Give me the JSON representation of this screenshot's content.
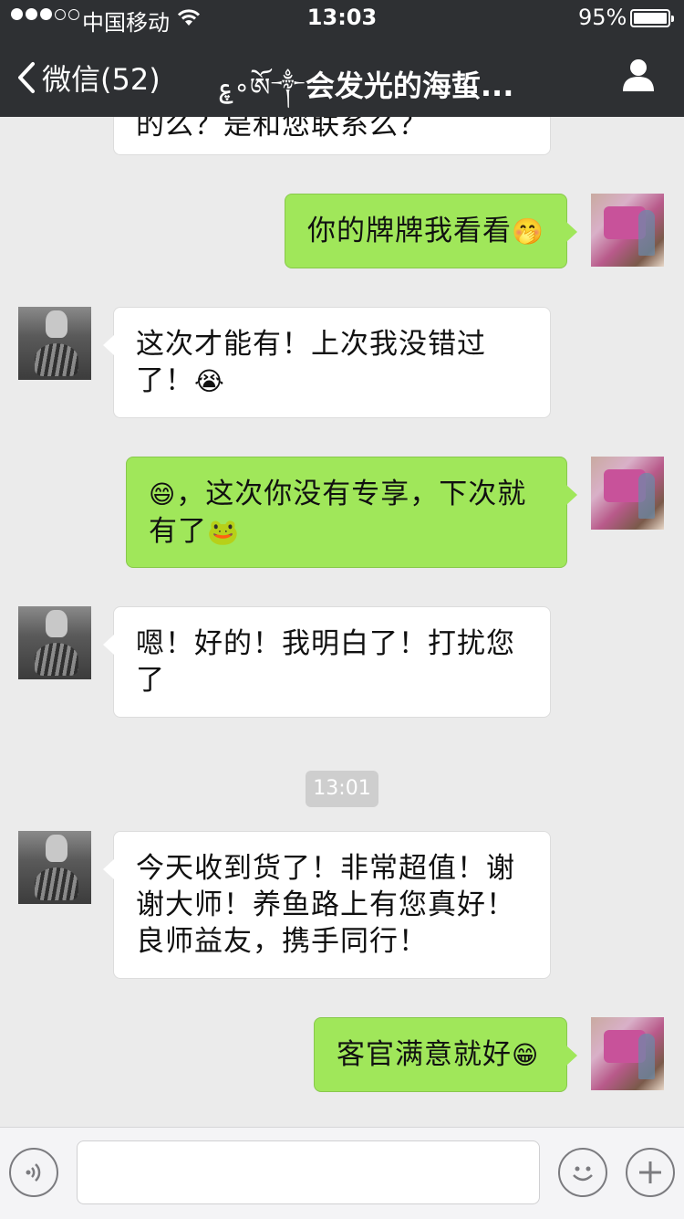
{
  "status_bar": {
    "carrier": "中国移动",
    "time": "13:03",
    "battery_percent": "95%",
    "battery_level": 0.95,
    "signal_bars_filled": 3,
    "signal_bars_total": 5
  },
  "nav": {
    "back_label": "微信(52)",
    "title_decoration": "ࢳ∘ཨོ༒",
    "title": "会发光的海蜇...",
    "profile_icon": "person-icon"
  },
  "messages": [
    {
      "side": "in",
      "text": "的么？是和您联系么？",
      "emoji": ""
    },
    {
      "side": "out",
      "text": "你的牌牌我看看",
      "emoji": "🤭"
    },
    {
      "side": "in",
      "text": "这次才能有！上次我没错过了！",
      "emoji": "😭"
    },
    {
      "side": "out",
      "text": "，这次你没有专享，下次就有了",
      "lead_emoji": "😄",
      "emoji": "🐸"
    },
    {
      "side": "in",
      "text": "嗯！好的！我明白了！打扰您了",
      "emoji": ""
    },
    {
      "side": "in",
      "text": "今天收到货了！非常超值！谢谢大师！养鱼路上有您真好！良师益友，携手同行！",
      "emoji": ""
    },
    {
      "side": "out",
      "text": "客官满意就好",
      "emoji": "😁"
    }
  ],
  "timestamp": "13:01",
  "input_bar": {
    "voice_icon": "voice-icon",
    "emoji_icon": "smiley-icon",
    "more_icon": "plus-icon",
    "input_value": ""
  },
  "colors": {
    "nav_bg": "#2e3033",
    "chat_bg": "#ebebeb",
    "outgoing_bubble": "#a0e75a",
    "incoming_bubble": "#ffffff"
  }
}
